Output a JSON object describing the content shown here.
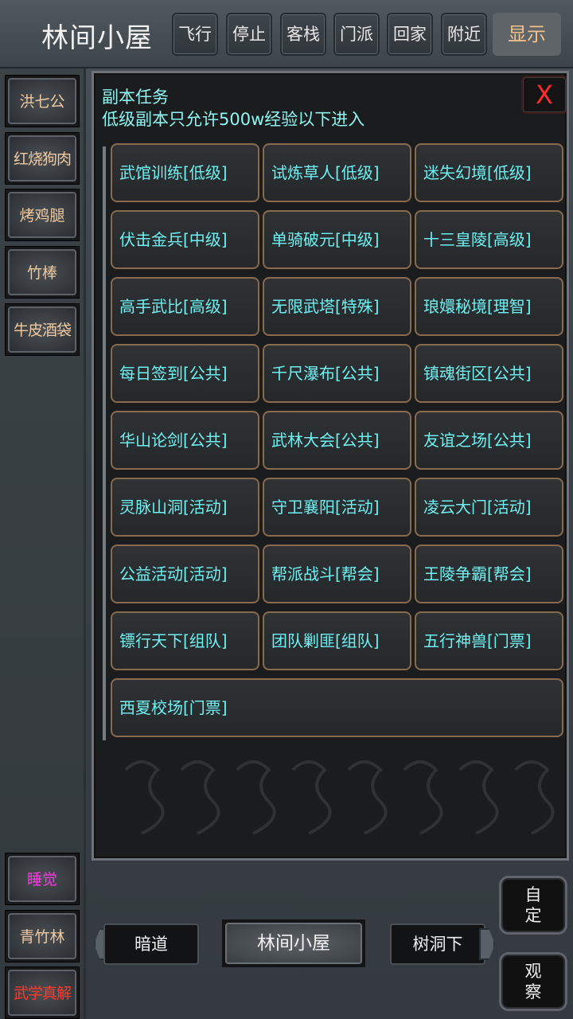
{
  "header": {
    "location": "林间小屋",
    "buttons": [
      "飞行",
      "停止",
      "客栈",
      "门派",
      "回家",
      "附近"
    ],
    "show_label": "显示"
  },
  "sidebar": {
    "items": [
      "洪七公",
      "红烧狗肉",
      "烤鸡腿",
      "竹棒",
      "牛皮酒袋"
    ],
    "bottom_items": [
      "睡觉",
      "青竹林",
      "武学真解"
    ]
  },
  "panel": {
    "title": "副本任务",
    "subtitle": "低级副本只允许500w经验以下进入",
    "close_label": "X",
    "tasks": [
      "武馆训练[低级]",
      "试炼草人[低级]",
      "迷失幻境[低级]",
      "伏击金兵[中级]",
      "单骑破元[中级]",
      "十三皇陵[高级]",
      "高手武比[高级]",
      "无限武塔[特殊]",
      "琅嬛秘境[理智]",
      "每日签到[公共]",
      "千尺瀑布[公共]",
      "镇魂街区[公共]",
      "华山论剑[公共]",
      "武林大会[公共]",
      "友谊之场[公共]",
      "灵脉山洞[活动]",
      "守卫襄阳[活动]",
      "凌云大门[活动]",
      "公益活动[活动]",
      "帮派战斗[帮会]",
      "王陵争霸[帮会]",
      "镖行天下[组队]",
      "团队剿匪[组队]",
      "五行神兽[门票]",
      "西夏校场[门票]"
    ]
  },
  "bottom": {
    "west_exit": "暗道",
    "current": "林间小屋",
    "east_exit": "树洞下",
    "custom_label": "自定",
    "observe_label": "观察"
  },
  "colors": {
    "task_text": "#6ff0f0",
    "panel_text": "#8ff5f0",
    "sleep": "#ff36e8",
    "special": "#ff3a2a",
    "side_text": "#f0c9a0",
    "show_text": "#f4c18a",
    "task_border": "#8a6a4c"
  }
}
